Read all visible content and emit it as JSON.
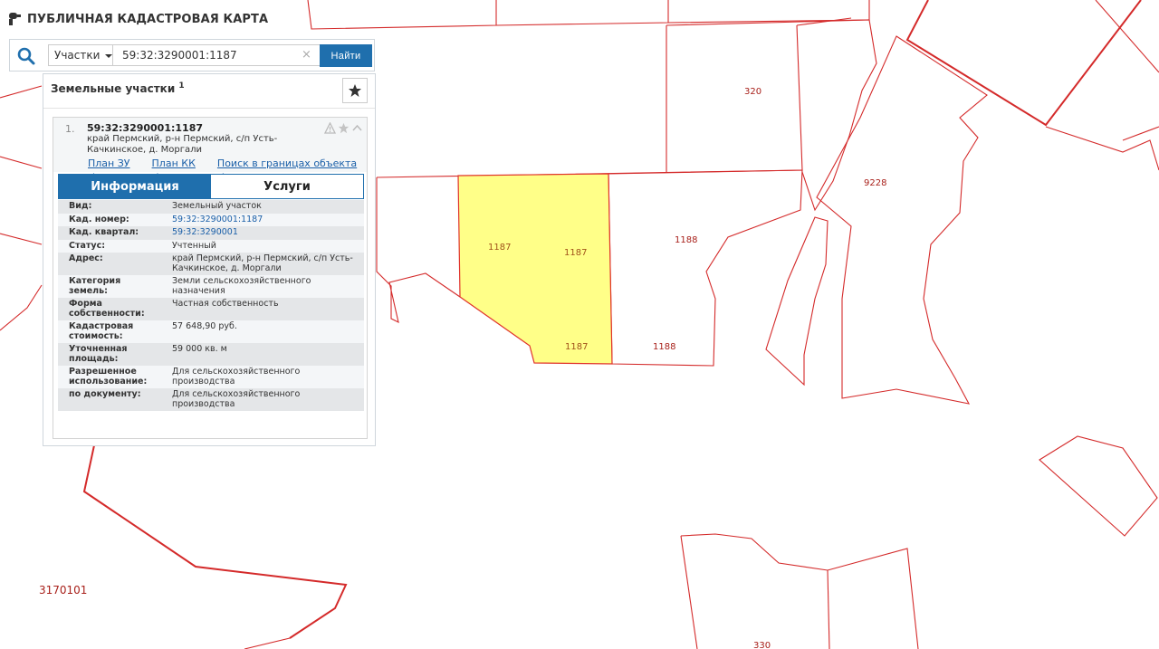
{
  "app": {
    "title": "ПУБЛИЧНАЯ КАДАСТРОВАЯ КАРТА"
  },
  "search": {
    "type_label": "Участки",
    "query": "59:32:3290001:1187",
    "clear_symbol": "×",
    "button_label": "Найти"
  },
  "results": {
    "header": "Земельные участки",
    "count": "1",
    "item": {
      "index": "1.",
      "number": "59:32:3290001:1187",
      "address": "край Пермский, р-н Пермский, с/п Усть-Качкинское, д. Моргали",
      "links": [
        "План ЗУ →",
        "План КК →",
        "Поиск в границах объекта →"
      ],
      "tabs": [
        "Информация",
        "Услуги"
      ],
      "active_tab": "Информация",
      "info": [
        {
          "key": "Вид:",
          "value": "Земельный участок"
        },
        {
          "key": "Кад. номер:",
          "value": "59:32:3290001:1187",
          "link": true
        },
        {
          "key": "Кад. квартал:",
          "value": "59:32:3290001",
          "link": true
        },
        {
          "key": "Статус:",
          "value": "Учтенный"
        },
        {
          "key": "Адрес:",
          "value": "край Пермский, р-н Пермский, с/п Усть-Качкинское, д. Моргали"
        },
        {
          "key": "Категория земель:",
          "value": "Земли сельскохозяйственного назначения"
        },
        {
          "key": "Форма собственности:",
          "value": "Частная собственность"
        },
        {
          "key": "Кадастровая стоимость:",
          "value": "57 648,90 руб."
        },
        {
          "key": "Уточненная площадь:",
          "value": "59 000 кв. м"
        },
        {
          "key": "Разрешенное использование:",
          "value": "Для сельскохозяйственного производства"
        },
        {
          "key": "по документу:",
          "value": "Для сельскохозяйственного производства"
        }
      ]
    }
  },
  "map": {
    "labels": {
      "l320": "320",
      "l9228": "9228",
      "sel_1": "1187",
      "sel_2": "1187",
      "sel_3": "1187",
      "n1188_a": "1188",
      "n1188_b": "1188",
      "quarter": "3170101",
      "l330": "330"
    },
    "colors": {
      "boundary": "#d42a2a",
      "selected_fill": "#ffff88",
      "accent": "#1f6fad"
    }
  }
}
